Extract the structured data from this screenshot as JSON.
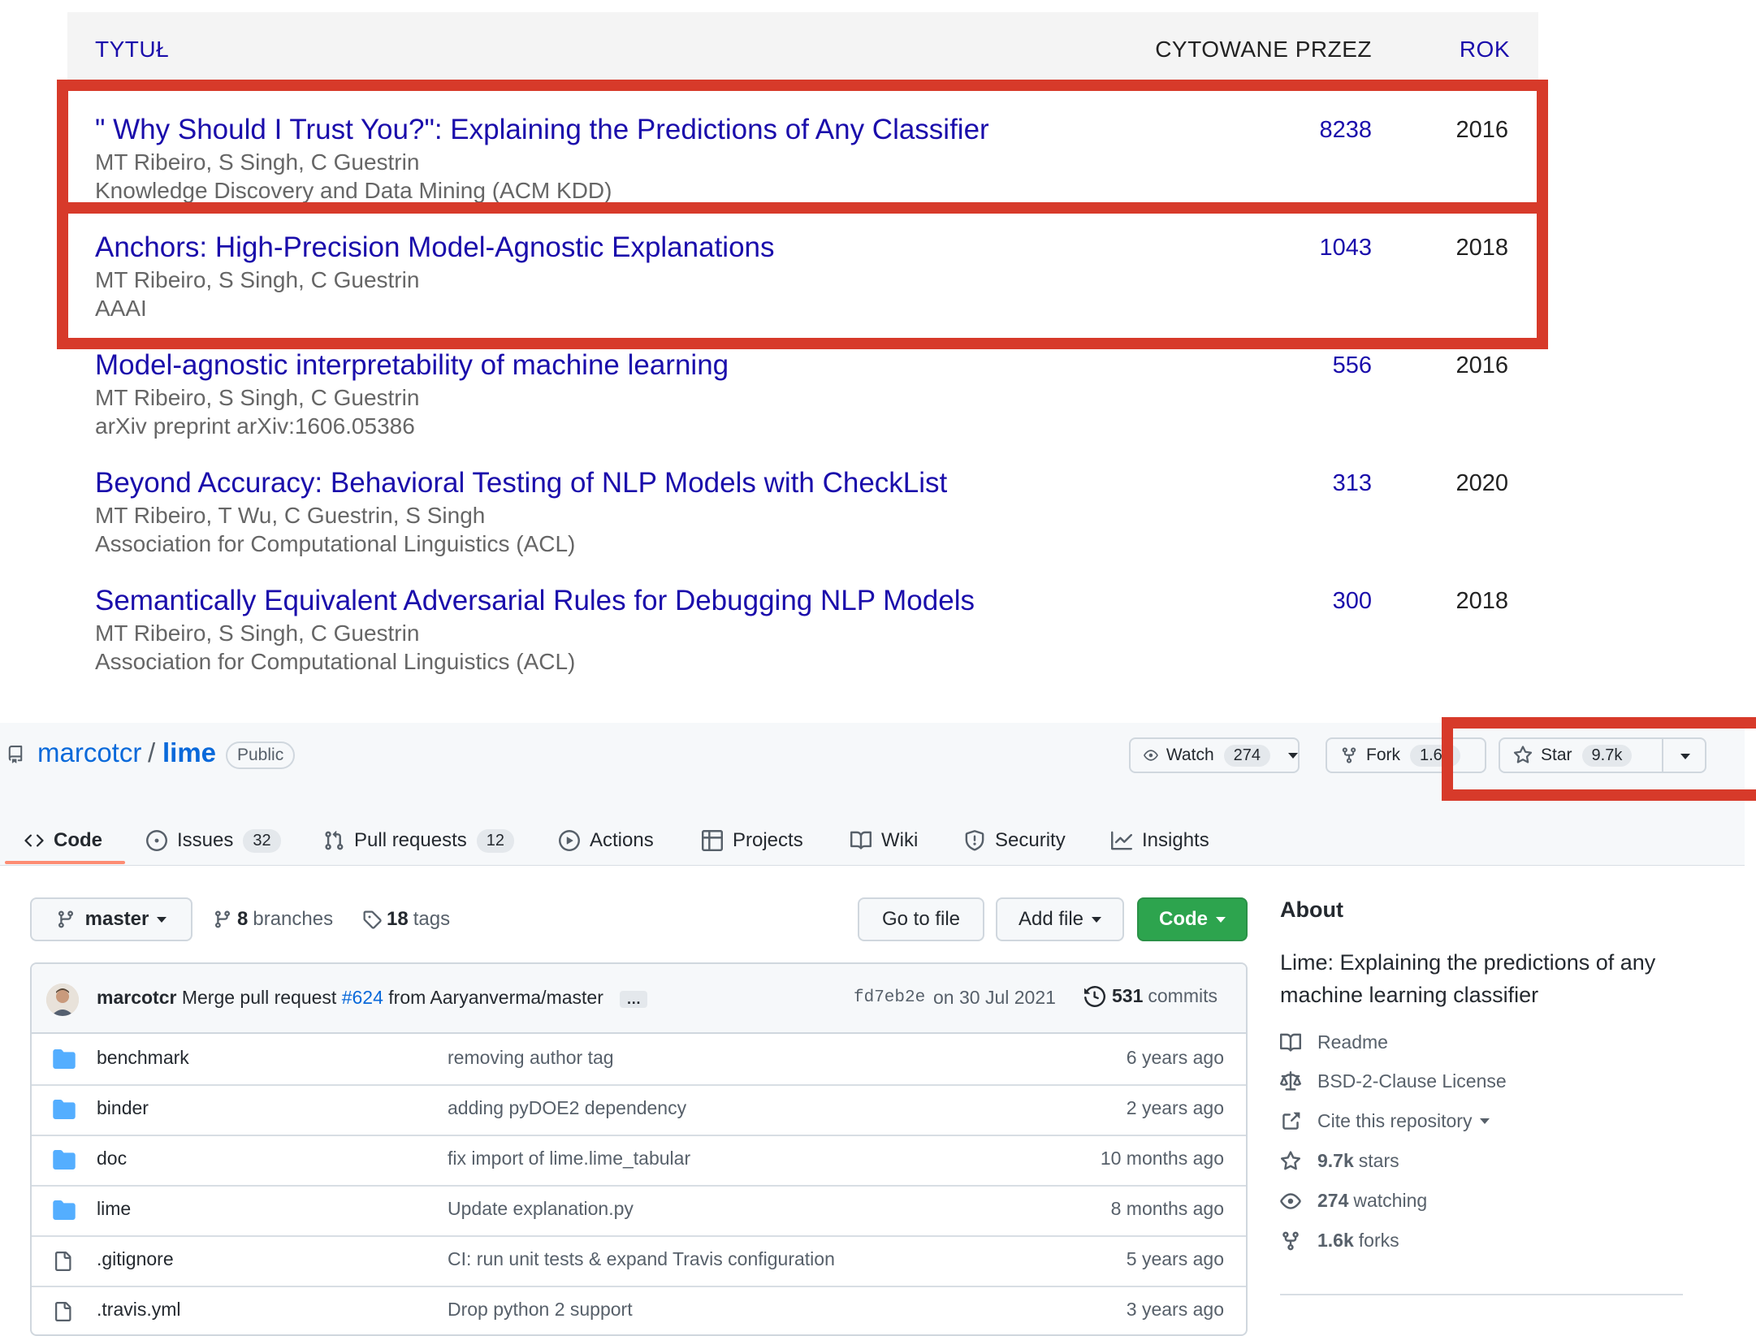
{
  "scholar": {
    "headers": {
      "title": "TYTUŁ",
      "cited": "CYTOWANE PRZEZ",
      "year": "ROK"
    },
    "papers": [
      {
        "title": "\" Why Should I Trust You?\": Explaining the Predictions of Any Classifier",
        "authors": "MT Ribeiro, S Singh, C Guestrin",
        "venue": "Knowledge Discovery and Data Mining (ACM KDD)",
        "cited": "8238",
        "year": "2016"
      },
      {
        "title": "Anchors: High-Precision Model-Agnostic Explanations",
        "authors": "MT Ribeiro, S Singh, C Guestrin",
        "venue": "AAAI",
        "cited": "1043",
        "year": "2018"
      },
      {
        "title": "Model-agnostic interpretability of machine learning",
        "authors": "MT Ribeiro, S Singh, C Guestrin",
        "venue": "arXiv preprint arXiv:1606.05386",
        "cited": "556",
        "year": "2016"
      },
      {
        "title": "Beyond Accuracy: Behavioral Testing of NLP Models with CheckList",
        "authors": "MT Ribeiro, T Wu, C Guestrin, S Singh",
        "venue": "Association for Computational Linguistics (ACL)",
        "cited": "313",
        "year": "2020"
      },
      {
        "title": "Semantically Equivalent Adversarial Rules for Debugging NLP Models",
        "authors": "MT Ribeiro, S Singh, C Guestrin",
        "venue": "Association for Computational Linguistics (ACL)",
        "cited": "300",
        "year": "2018"
      }
    ]
  },
  "repo": {
    "owner": "marcotcr",
    "slash": "/",
    "name": "lime",
    "visibility": "Public",
    "watch_label": "Watch",
    "watch_count": "274",
    "fork_label": "Fork",
    "fork_count": "1.6k",
    "star_label": "Star",
    "star_count": "9.7k"
  },
  "tabs": [
    {
      "label": "Code"
    },
    {
      "label": "Issues",
      "count": "32"
    },
    {
      "label": "Pull requests",
      "count": "12"
    },
    {
      "label": "Actions"
    },
    {
      "label": "Projects"
    },
    {
      "label": "Wiki"
    },
    {
      "label": "Security"
    },
    {
      "label": "Insights"
    }
  ],
  "toolbar": {
    "branch": "master",
    "branches_count": "8",
    "branches_label": "branches",
    "tags_count": "18",
    "tags_label": "tags",
    "goto_file": "Go to file",
    "add_file": "Add file",
    "code": "Code"
  },
  "commit": {
    "author": "marcotcr",
    "message_prefix": "Merge pull request",
    "pr": "#624",
    "message_suffix": "from Aaryanverma/master",
    "ellipsis": "…",
    "sha": "fd7eb2e",
    "date": "on 30 Jul 2021",
    "count": "531",
    "count_label": "commits"
  },
  "files": [
    {
      "name": "benchmark",
      "type": "dir",
      "message": "removing author tag",
      "age": "6 years ago"
    },
    {
      "name": "binder",
      "type": "dir",
      "message": "adding pyDOE2 dependency",
      "age": "2 years ago"
    },
    {
      "name": "doc",
      "type": "dir",
      "message": "fix import of lime.lime_tabular",
      "age": "10 months ago"
    },
    {
      "name": "lime",
      "type": "dir",
      "message": "Update explanation.py",
      "age": "8 months ago"
    },
    {
      "name": ".gitignore",
      "type": "file",
      "message": "CI: run unit tests & expand Travis configuration",
      "age": "5 years ago"
    },
    {
      "name": ".travis.yml",
      "type": "file",
      "message": "Drop python 2 support",
      "age": "3 years ago"
    }
  ],
  "about": {
    "heading": "About",
    "description": "Lime: Explaining the predictions of any machine learning classifier",
    "readme": "Readme",
    "license": "BSD-2-Clause License",
    "cite": "Cite this repository",
    "stars_count": "9.7k",
    "stars_label": "stars",
    "watching_count": "274",
    "watching_label": "watching",
    "forks_count": "1.6k",
    "forks_label": "forks"
  },
  "colors": {
    "scholar_link": "#1a0dab",
    "github_link": "#0969da",
    "highlight_box": "#d73a2a",
    "code_button": "#2da44e",
    "folder_icon": "#54aeff"
  }
}
